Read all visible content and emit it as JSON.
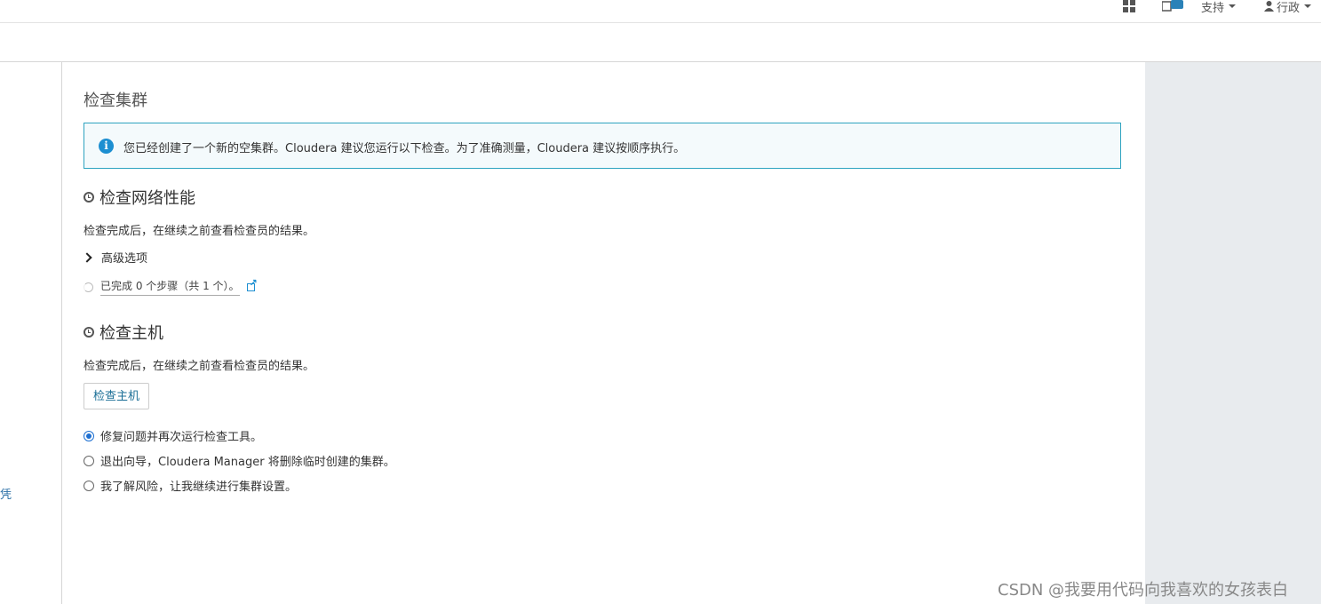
{
  "topnav": {
    "support_label": "支持",
    "user_label": "行政"
  },
  "sidebar": {
    "partial_text": "凭"
  },
  "main": {
    "page_title": "检查集群",
    "alert_text": "您已经创建了一个新的空集群。Cloudera 建议您运行以下检查。为了准确测量，Cloudera 建议按顺序执行。",
    "network": {
      "heading": "检查网络性能",
      "desc": "检查完成后，在继续之前查看检查员的结果。",
      "advanced_label": "高级选项",
      "steps_text": "已完成 0 个步骤（共 1 个）。"
    },
    "hosts": {
      "heading": "检查主机",
      "desc": "检查完成后，在继续之前查看检查员的结果。",
      "button_label": "检查主机"
    },
    "options": [
      {
        "label": "修复问题并再次运行检查工具。",
        "selected": true
      },
      {
        "label": "退出向导，Cloudera Manager 将删除临时创建的集群。",
        "selected": false
      },
      {
        "label": "我了解风险，让我继续进行集群设置。",
        "selected": false
      }
    ]
  },
  "watermark": "CSDN @我要用代码向我喜欢的女孩表白",
  "colors": {
    "accent": "#1d8fd1",
    "alert_border": "#2ea3c0",
    "right_panel": "#e8ebee"
  }
}
